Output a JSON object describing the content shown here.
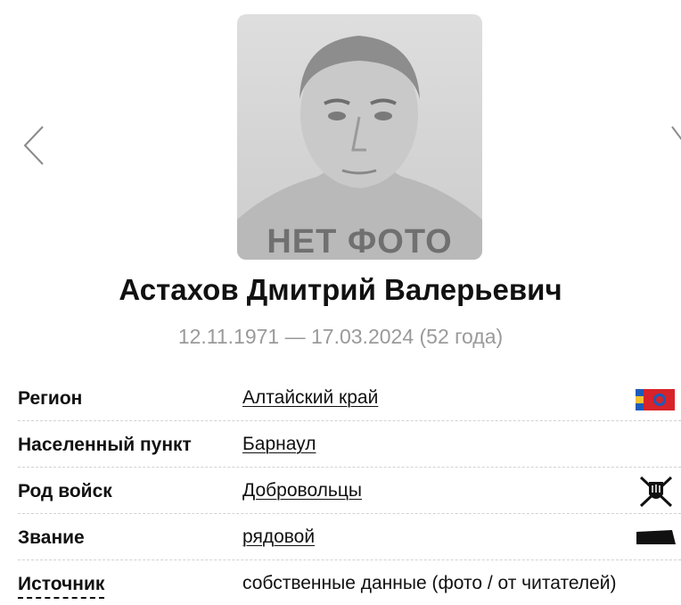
{
  "nav": {
    "prev_icon": "chevron-left-icon",
    "next_icon": "chevron-right-icon"
  },
  "photo": {
    "placeholder_text": "НЕТ ФОТО",
    "badge_icon": "flag-icon"
  },
  "person": {
    "name": "Астахов Дмитрий Валерьевич",
    "dates": "12.11.1971 — 17.03.2024 (52 года)"
  },
  "info": {
    "region": {
      "label": "Регион",
      "value": "Алтайский край",
      "icon": "altai-krai-flag-icon"
    },
    "settlement": {
      "label": "Населенный пункт",
      "value": "Барнаул"
    },
    "branch": {
      "label": "Род войск",
      "value": "Добровольцы",
      "icon": "volunteers-emblem-icon"
    },
    "rank": {
      "label": "Звание",
      "value": "рядовой",
      "icon": "rank-insignia-icon"
    },
    "source": {
      "label": "Источник",
      "value": "собственные данные (фото / от читателей)"
    }
  },
  "colors": {
    "badge": "#e0464e",
    "dates": "#9a9a9a",
    "divider": "#d2d2d2",
    "region_flag_red": "#d8232a",
    "region_flag_blue": "#1e5bb8"
  }
}
